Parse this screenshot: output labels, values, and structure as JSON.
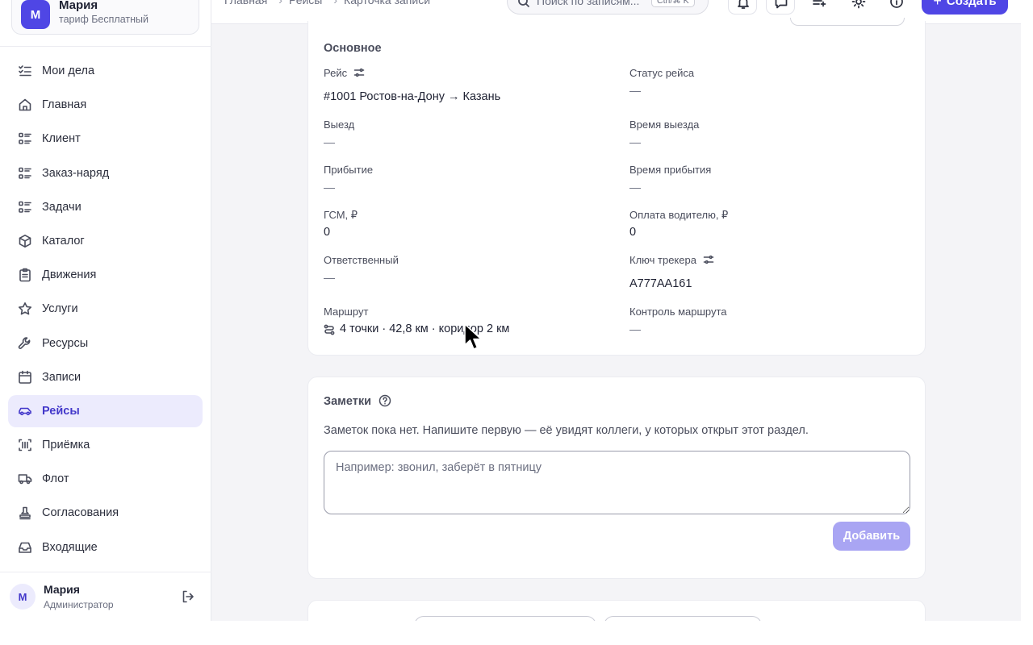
{
  "org": {
    "avatar_letter": "М",
    "name": "Мария",
    "plan": "тариф Бесплатный"
  },
  "nav": [
    {
      "label": "Мои дела",
      "icon": "list-check-icon",
      "active": false
    },
    {
      "label": "Главная",
      "icon": "home-icon",
      "active": false
    },
    {
      "label": "Клиент",
      "icon": "list-icon",
      "active": false
    },
    {
      "label": "Заказ-наряд",
      "icon": "list-icon",
      "active": false
    },
    {
      "label": "Задачи",
      "icon": "list-icon",
      "active": false
    },
    {
      "label": "Каталог",
      "icon": "box-icon",
      "active": false
    },
    {
      "label": "Движения",
      "icon": "clipboard-icon",
      "active": false
    },
    {
      "label": "Услуги",
      "icon": "star-icon",
      "active": false
    },
    {
      "label": "Ресурсы",
      "icon": "wrench-icon",
      "active": false
    },
    {
      "label": "Записи",
      "icon": "calendar-icon",
      "active": false
    },
    {
      "label": "Рейсы",
      "icon": "car-icon",
      "active": true
    },
    {
      "label": "Приёмка",
      "icon": "scan-icon",
      "active": false
    },
    {
      "label": "Флот",
      "icon": "truck-icon",
      "active": false
    },
    {
      "label": "Согласования",
      "icon": "stamp-icon",
      "active": false
    },
    {
      "label": "Входящие",
      "icon": "inbox-icon",
      "active": false
    }
  ],
  "user": {
    "avatar_letter": "М",
    "name": "Мария",
    "role": "Администратор"
  },
  "topbar": {
    "breadcrumbs": [
      "Главная",
      "Рейсы",
      "Карточка записи"
    ],
    "search_placeholder": "Поиск по записям...",
    "search_shortcut": "Ctrl/⌘ K",
    "create_label": "Создать"
  },
  "main_section": {
    "title": "Основное",
    "fields": {
      "trip": {
        "label": "Рейс",
        "value": "#1001 Ростов-на-Дону → Казань"
      },
      "trip_status": {
        "label": "Статус рейса",
        "value": "—"
      },
      "departure": {
        "label": "Выезд",
        "value": "—"
      },
      "departure_time": {
        "label": "Время выезда",
        "value": "—"
      },
      "arrival": {
        "label": "Прибытие",
        "value": "—"
      },
      "arrival_time": {
        "label": "Время прибытия",
        "value": "—"
      },
      "fuel": {
        "label": "ГСМ, ₽",
        "value": "0"
      },
      "driver_pay": {
        "label": "Оплата водителю, ₽",
        "value": "0"
      },
      "responsible": {
        "label": "Ответственный",
        "value": "—"
      },
      "tracker_key": {
        "label": "Ключ трекера",
        "value": "А777АА161"
      },
      "route": {
        "label": "Маршрут",
        "value": "4 точки · 42,8 км · коридор 2 км"
      },
      "route_control": {
        "label": "Контроль маршрута",
        "value": "—"
      }
    }
  },
  "notes": {
    "title": "Заметки",
    "empty_text": "Заметок пока нет. Напишите первую — её увидят коллеги, у которых открыт этот раздел.",
    "placeholder": "Например: звонил, заберёт в пятницу",
    "add_label": "Добавить"
  }
}
